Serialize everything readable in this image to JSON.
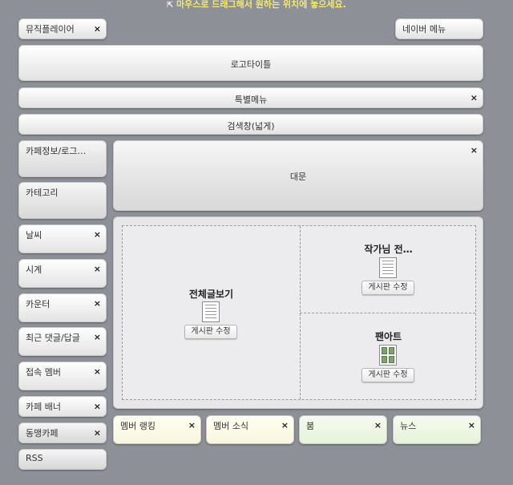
{
  "hint": "마우스로 드래그해서 원하는 위치에 놓으세요.",
  "widgets": {
    "music_player": "뮤직플레이어",
    "naver_menu": "네이버 메뉴",
    "logo_title": "로고타이틀",
    "special_menu": "특별메뉴",
    "search_wide": "검색창(넓게)",
    "cafe_info": "카페정보/로그…",
    "category": "카테고리",
    "weather": "날씨",
    "clock": "시계",
    "counter": "카운터",
    "recent_comments": "최근 댓글/답글",
    "online_members": "접속 멤버",
    "cafe_banner": "카페 배너",
    "alumni_cafe": "동맹카페",
    "rss": "RSS",
    "main_gate": "대문",
    "member_ranking": "멤버 랭킹",
    "member_news": "멤버 소식",
    "book": "붐",
    "news": "뉴스"
  },
  "main": {
    "all_posts_title": "전체글보기",
    "author_title": "작가님 전…",
    "fanart_title": "팬아트",
    "edit_board_label": "게시판 수정"
  },
  "close_glyph": "×"
}
